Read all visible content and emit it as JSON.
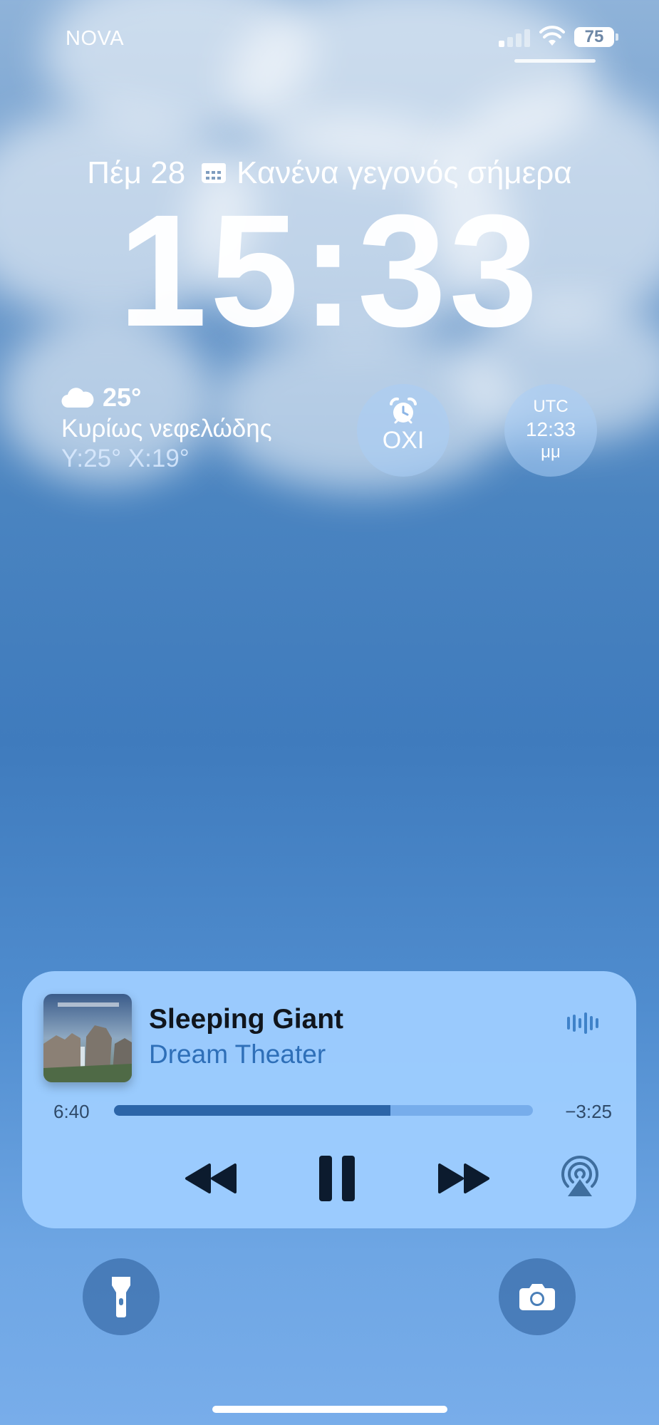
{
  "status_bar": {
    "carrier": "NOVA",
    "battery_level": "75",
    "signal_bars_active": 1,
    "signal_icon": "cellular-signal-icon",
    "wifi_icon": "wifi-icon"
  },
  "lock_screen": {
    "date": "Πέμ 28",
    "calendar_icon": "calendar-icon",
    "calendar_text": "Κανένα γεγονός σήμερα",
    "time": "15:33"
  },
  "widgets": {
    "weather": {
      "icon": "cloud-icon",
      "temperature": "25°",
      "condition": "Κυρίως νεφελώδης",
      "high_low": "Υ:25° Χ:19°"
    },
    "alarm": {
      "icon": "alarm-clock-icon",
      "label": "ΟΧΙ"
    },
    "world_clock": {
      "zone": "UTC",
      "time": "12:33",
      "period": "μμ"
    }
  },
  "now_playing": {
    "track": "Sleeping Giant",
    "artist": "Dream Theater",
    "elapsed": "6:40",
    "remaining": "−3:25",
    "progress": 0.66,
    "controls": [
      "rewind-icon",
      "pause-icon",
      "fast-forward-icon",
      "airplay-icon"
    ],
    "colors": {
      "accent": "#2e6fb8",
      "card": "#9ecdff"
    }
  },
  "quick_actions": {
    "left": "flashlight-icon",
    "right": "camera-icon"
  }
}
